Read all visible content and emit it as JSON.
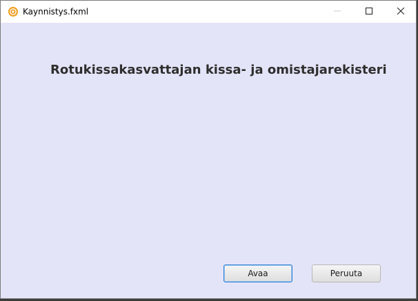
{
  "window": {
    "title": "Kaynnistys.fxml",
    "controls": {
      "minimize": "minimize-icon",
      "maximize": "maximize-icon",
      "close": "close-icon"
    }
  },
  "main": {
    "heading": "Rotukissakasvattajan kissa- ja omistajarekisteri"
  },
  "buttons": {
    "open_label": "Avaa",
    "cancel_label": "Peruuta"
  },
  "colors": {
    "content_background": "#e4e4f8",
    "focus_border": "#2a7fd4",
    "app_icon": "#f0a020"
  }
}
